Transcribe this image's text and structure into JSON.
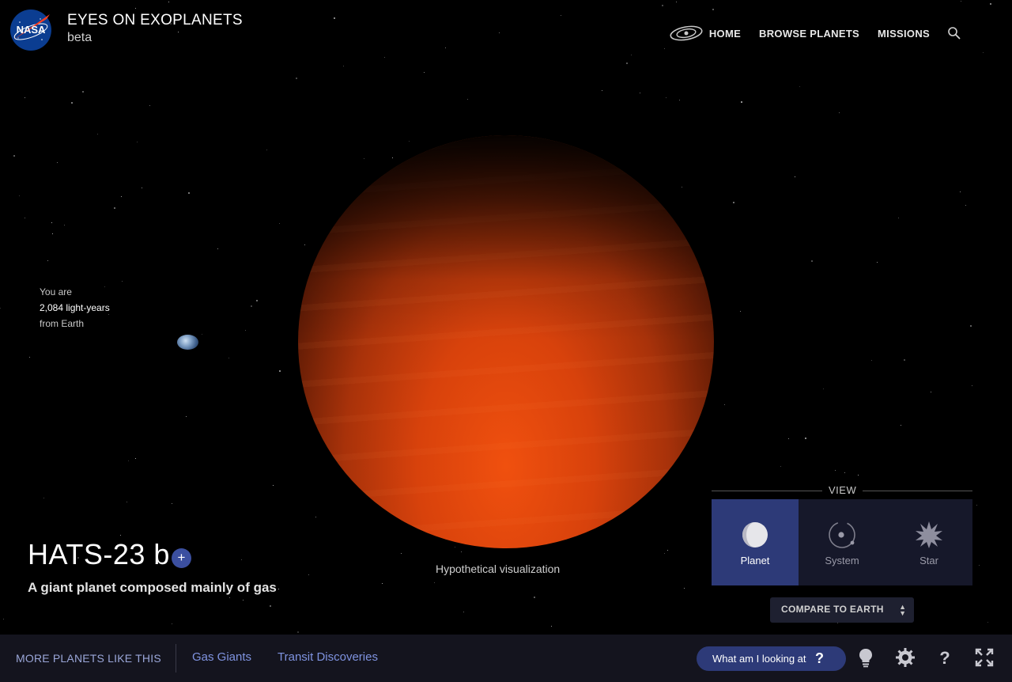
{
  "header": {
    "logo_text": "NASA",
    "title": "EYES ON EXOPLANETS",
    "subtitle": "beta",
    "nav": [
      {
        "label": "HOME",
        "icon": "galaxy-icon"
      },
      {
        "label": "BROWSE PLANETS"
      },
      {
        "label": "MISSIONS"
      }
    ],
    "search_icon": "search-icon"
  },
  "distance": {
    "line1": "You are",
    "line2": "2,084 light-years",
    "line3": "from Earth"
  },
  "planet": {
    "name": "HATS-23 b",
    "add_label": "+",
    "description": "A giant planet composed mainly of gas",
    "caption": "Hypothetical visualization",
    "color": "#e04810"
  },
  "view": {
    "label": "VIEW",
    "options": [
      {
        "label": "Planet",
        "active": true
      },
      {
        "label": "System",
        "active": false
      },
      {
        "label": "Star",
        "active": false
      }
    ],
    "compare_label": "COMPARE TO EARTH"
  },
  "bottom": {
    "more_label": "MORE PLANETS LIKE THIS",
    "categories": [
      "Gas Giants",
      "Transit Discoveries"
    ],
    "what_label": "What am I looking at",
    "what_icon": "?"
  },
  "colors": {
    "accent": "#2d3a78",
    "link": "#7f93e0",
    "bar": "#14141e"
  }
}
